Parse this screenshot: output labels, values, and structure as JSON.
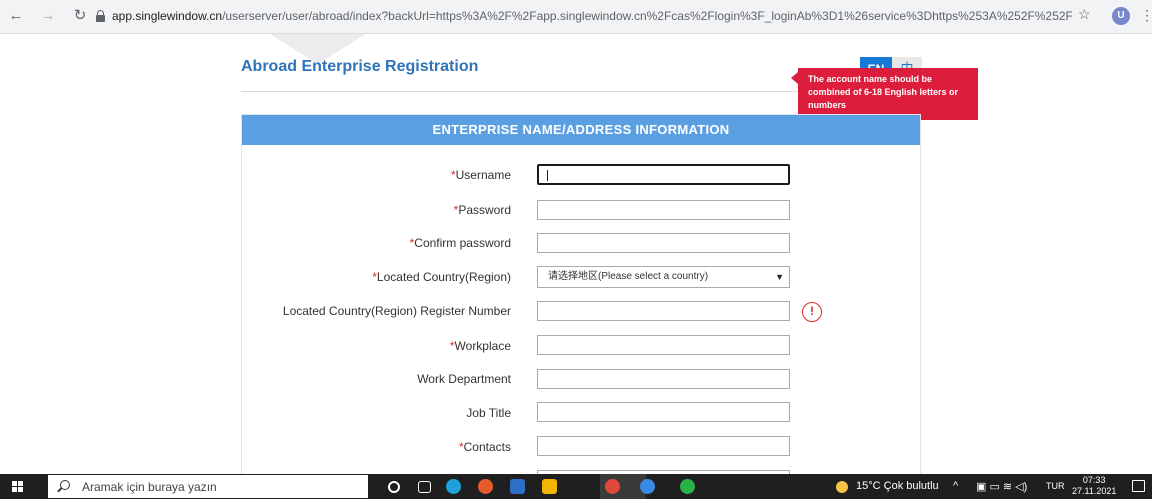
{
  "browser": {
    "url_host": "app.singlewindow.cn",
    "url_rest": "/userserver/user/abroad/index?backUrl=https%3A%2F%2Fapp.singlewindow.cn%2Fcas%2Flogin%3F_loginAb%3D1%26service%3Dhttps%253A%252F%252Fci...",
    "profile_initial": "U"
  },
  "page": {
    "title": "Abroad Enterprise Registration",
    "lang_en": "EN",
    "lang_zh": "中",
    "tooltip": "The account name should be combined of 6-18 English letters or numbers",
    "section_title": "ENTERPRISE NAME/ADDRESS INFORMATION"
  },
  "form": {
    "required_mark": "*",
    "fields": [
      {
        "label": "Username",
        "required": true,
        "value": ""
      },
      {
        "label": "Password",
        "required": true,
        "value": ""
      },
      {
        "label": "Confirm password",
        "required": true,
        "value": ""
      },
      {
        "label": "Located Country(Region)",
        "required": true,
        "value": "请选择地区(Please select a country)"
      },
      {
        "label": "Located Country(Region) Register Number",
        "required": false,
        "value": ""
      },
      {
        "label": "Workplace",
        "required": true,
        "value": ""
      },
      {
        "label": "Work Department",
        "required": false,
        "value": ""
      },
      {
        "label": "Job Title",
        "required": false,
        "value": ""
      },
      {
        "label": "Contacts",
        "required": true,
        "value": ""
      }
    ],
    "warning_glyph": "!"
  },
  "taskbar": {
    "search_placeholder": "Aramak için buraya yazın",
    "weather": "15°C  Çok bulutlu",
    "language": "TUR",
    "time": "07:33",
    "date": "27.11.2021"
  },
  "colors": {
    "brand_blue": "#2f73b9",
    "section_blue": "#5b9fe3",
    "error_red": "#dc1e3c"
  }
}
